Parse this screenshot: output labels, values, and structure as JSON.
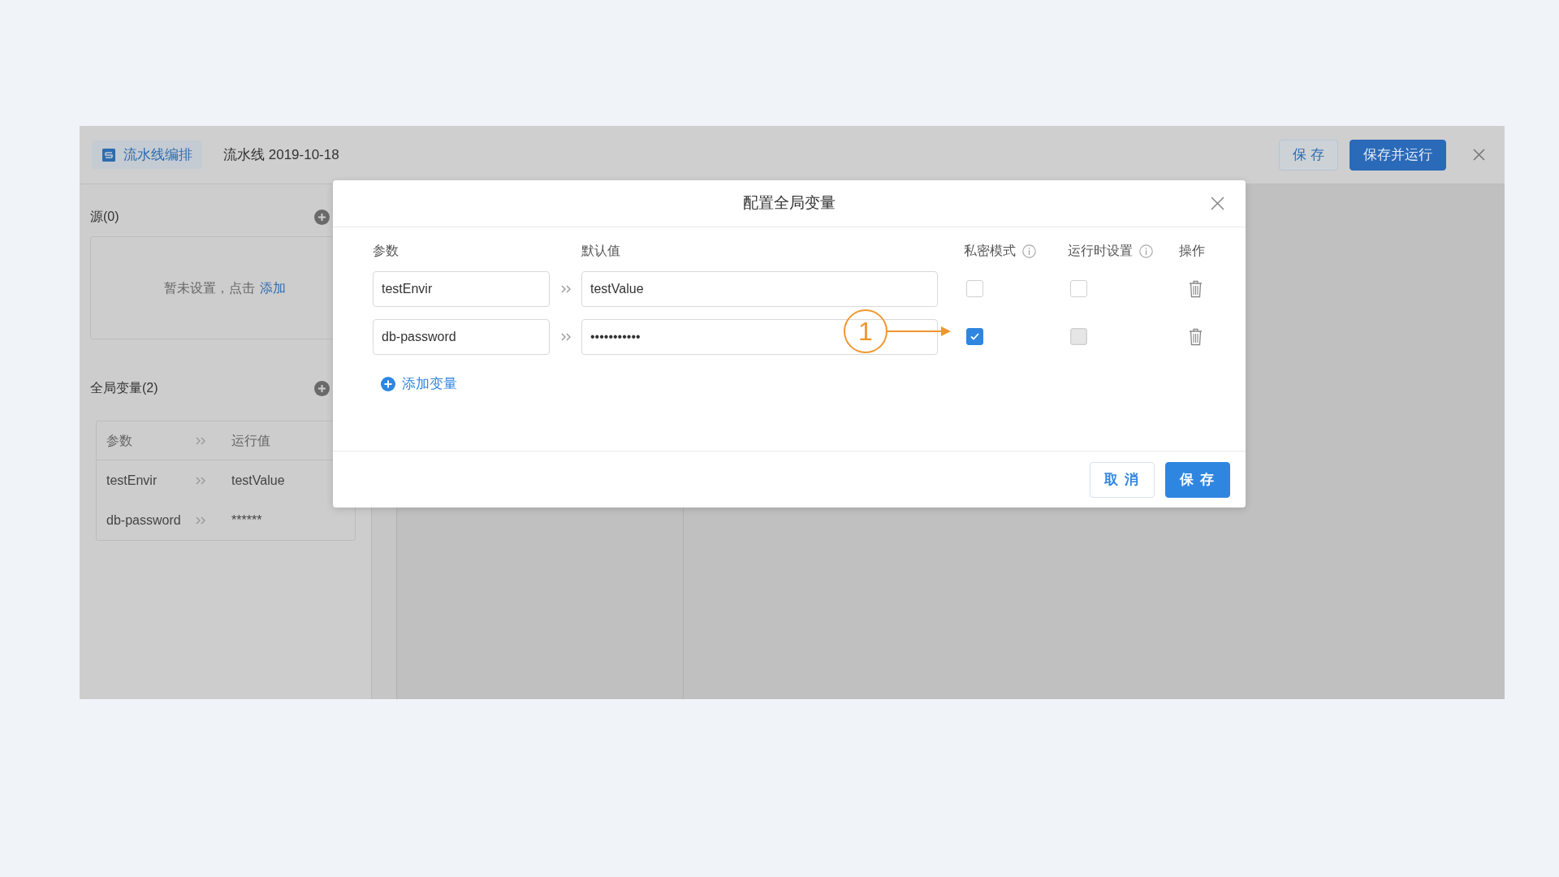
{
  "header": {
    "module_tab": "流水线编排",
    "pipeline_name": "流水线 2019-10-18",
    "buttons": [
      {
        "label": "保 存",
        "kind": "outline"
      },
      {
        "label": "保存并运行",
        "kind": "primary"
      }
    ]
  },
  "sidebar": {
    "sources": {
      "title": "源(0)",
      "empty_text": "暂未设置，点击",
      "empty_link": "添加"
    },
    "globals": {
      "title": "全局变量(2)",
      "columns": [
        "参数",
        "运行值"
      ],
      "rows": [
        {
          "name": "testEnvir",
          "value": "testValue"
        },
        {
          "name": "db-password",
          "value": "******"
        }
      ]
    }
  },
  "modal": {
    "title": "配置全局变量",
    "columns": [
      {
        "label": "参数",
        "info": false
      },
      {
        "label": "默认值",
        "info": false
      },
      {
        "label": "私密模式",
        "info": true
      },
      {
        "label": "运行时设置",
        "info": true
      },
      {
        "label": "操作",
        "info": false
      }
    ],
    "rows": [
      {
        "param": "testEnvir",
        "value": "testValue",
        "private": {
          "checked": false
        },
        "runtime": {
          "checked": false,
          "disabled": false
        }
      },
      {
        "param": "db-password",
        "value": "•••••••••••",
        "private": {
          "checked": true
        },
        "runtime": {
          "checked": false,
          "disabled": true
        }
      }
    ],
    "add_label": "添加变量",
    "annotation": {
      "label": "1"
    },
    "buttons": [
      {
        "label": "取 消",
        "kind": "outline"
      },
      {
        "label": "保 存",
        "kind": "primary"
      }
    ]
  }
}
